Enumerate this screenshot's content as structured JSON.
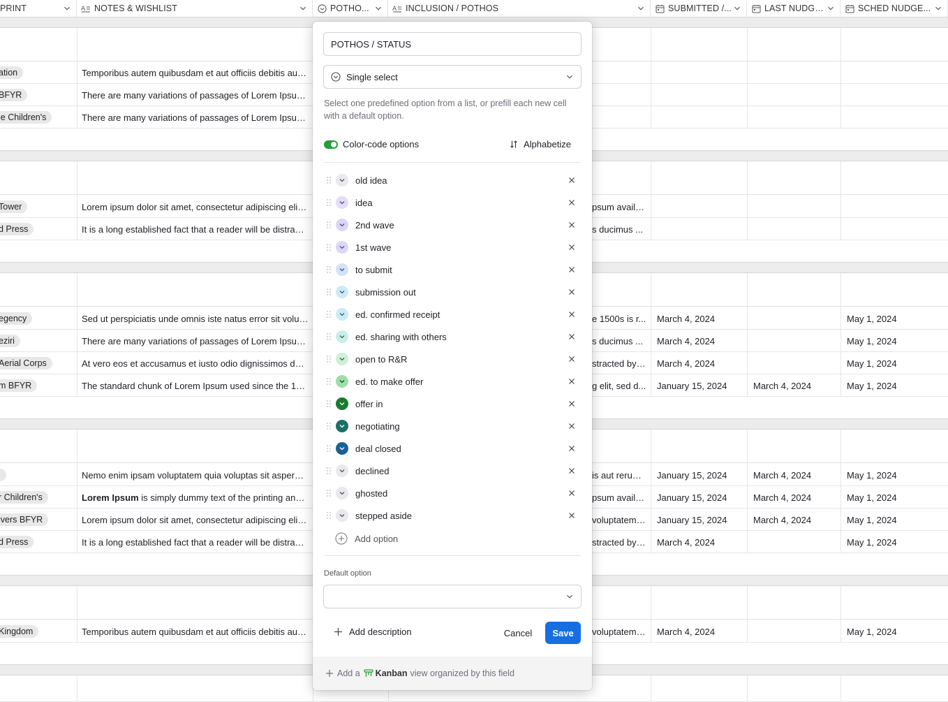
{
  "columns": [
    {
      "name": "PRINT",
      "icon": "none"
    },
    {
      "name": "NOTES & WISHLIST",
      "icon": "text-icon"
    },
    {
      "name": "POTHO...",
      "icon": "single-select-icon"
    },
    {
      "name": "INCLUSION / POTHOS",
      "icon": "text-icon"
    },
    {
      "name": "SUBMITTED /...",
      "icon": "calendar-icon"
    },
    {
      "name": "LAST NUDGE...",
      "icon": "calendar-icon"
    },
    {
      "name": "SCHED NUDGE...",
      "icon": "calendar-icon"
    }
  ],
  "rows": [
    {
      "pill": "ation",
      "note": "Temporibus autem quibusdam et aut officiis debitis aut rerum",
      "incl": "",
      "sub": "",
      "last": "",
      "sched": ""
    },
    {
      "pill": "BFYR",
      "note": "There are many variations of passages of Lorem Ipsum available",
      "incl": "",
      "sub": "",
      "last": "",
      "sched": ""
    },
    {
      "pill": "le Children's",
      "note": "There are many variations of passages of Lorem Ipsum available",
      "incl": "",
      "sub": "",
      "last": "",
      "sched": ""
    },
    {
      "pill": "Tower",
      "note": "Lorem ipsum dolor sit amet, consectetur adipiscing elit, sed do",
      "incl": "psum availa...",
      "sub": "",
      "last": "",
      "sched": ""
    },
    {
      "pill": "d Press",
      "note": "It is a long established fact that a reader will be distracted",
      "incl": "s ducimus ...",
      "sub": "",
      "last": "",
      "sched": ""
    },
    {
      "pill": "egency",
      "note": "Sed ut perspiciatis unde omnis iste natus error sit voluptatem",
      "incl": "e 1500s is r...",
      "sub": "March 4, 2024",
      "last": "",
      "sched": "May 1, 2024"
    },
    {
      "pill": "eziri",
      "note": "There are many variations of passages of Lorem Ipsum available",
      "incl": "s ducimus ...",
      "sub": "March 4, 2024",
      "last": "",
      "sched": "May 1, 2024"
    },
    {
      "pill": "Aerial Corps",
      "note": "At vero eos et accusamus et iusto odio dignissimos ducimus",
      "incl": "stracted by ...",
      "sub": "March 4, 2024",
      "last": "",
      "sched": "May 1, 2024"
    },
    {
      "pill": "m BFYR",
      "note": "The standard chunk of Lorem Ipsum used since the 1500s is",
      "incl": "g elit, sed d...",
      "sub": "January 15, 2024",
      "last": "March 4, 2024",
      "sched": "May 1, 2024"
    },
    {
      "pill": "i",
      "note": "Nemo enim ipsam voluptatem quia voluptas sit aspernatur aut",
      "incl": "is aut rerum...",
      "sub": "January 15, 2024",
      "last": "March 4, 2024",
      "sched": "May 1, 2024"
    },
    {
      "pill": "r Children's",
      "note_bold": "Lorem Ipsum",
      "note": " is simply dummy text of the printing and typesetting",
      "incl": "psum availa...",
      "sub": "January 15, 2024",
      "last": "March 4, 2024",
      "sched": "May 1, 2024"
    },
    {
      "pill": "ivers BFYR",
      "note": "Lorem ipsum dolor sit amet, consectetur adipiscing elit, sed do",
      "incl": "voluptatem ...",
      "sub": "January 15, 2024",
      "last": "March 4, 2024",
      "sched": "May 1, 2024"
    },
    {
      "pill": "d Press",
      "note": "It is a long established fact that a reader will be distracted",
      "incl": "stracted by ...",
      "sub": "March 4, 2024",
      "last": "",
      "sched": "May 1, 2024"
    },
    {
      "pill": "Kingdom",
      "note": "Temporibus autem quibusdam et aut officiis debitis aut rerum",
      "incl": "voluptatem ...",
      "sub": "March 4, 2024",
      "last": "",
      "sched": "May 1, 2024"
    }
  ],
  "popup": {
    "field_name": "POTHOS / STATUS",
    "field_type": "Single select",
    "description": "Select one predefined option from a list, or prefill each new cell with a default option.",
    "color_code_label": "Color-code options",
    "color_code_on": true,
    "alphabetize_label": "Alphabetize",
    "options": [
      {
        "label": "old idea",
        "color": "#e9e9ee",
        "chev": "#555"
      },
      {
        "label": "idea",
        "color": "#e3dcfb",
        "chev": "#555"
      },
      {
        "label": "2nd wave",
        "color": "#dcd4fb",
        "chev": "#555"
      },
      {
        "label": "1st wave",
        "color": "#ddd6fb",
        "chev": "#555"
      },
      {
        "label": "to submit",
        "color": "#d5e2fb",
        "chev": "#555"
      },
      {
        "label": "submission out",
        "color": "#cdeafa",
        "chev": "#555"
      },
      {
        "label": "ed. confirmed receipt",
        "color": "#c9ebf7",
        "chev": "#555"
      },
      {
        "label": "ed. sharing with others",
        "color": "#c6efe9",
        "chev": "#555"
      },
      {
        "label": "open to R&R",
        "color": "#cdf1d6",
        "chev": "#555"
      },
      {
        "label": "ed. to make offer",
        "color": "#9be0a8",
        "chev": "#3a3a3a"
      },
      {
        "label": "offer in",
        "color": "#1a7a2e",
        "chev": "#ffffff"
      },
      {
        "label": "negotiating",
        "color": "#1d6e66",
        "chev": "#ffffff"
      },
      {
        "label": "deal closed",
        "color": "#1a5f96",
        "chev": "#ffffff"
      },
      {
        "label": "declined",
        "color": "#e9e9ee",
        "chev": "#555"
      },
      {
        "label": "ghosted",
        "color": "#e9e9ee",
        "chev": "#555"
      },
      {
        "label": "stepped aside",
        "color": "#e9e9ee",
        "chev": "#555"
      }
    ],
    "add_option_label": "Add option",
    "default_option_label": "Default option",
    "default_option_value": "",
    "add_description_label": "Add description",
    "cancel_label": "Cancel",
    "save_label": "Save",
    "footer": {
      "prefix": "Add a",
      "view_name": "Kanban",
      "suffix": "view organized by this field"
    }
  },
  "colors": {
    "accent": "#166ee1",
    "toggle": "#20a036",
    "kanban": "#20a036"
  }
}
